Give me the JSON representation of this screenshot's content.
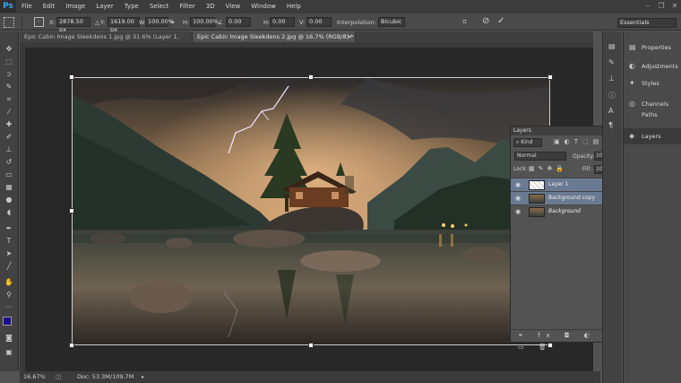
{
  "app": {
    "logo": "Ps"
  },
  "menu": [
    "File",
    "Edit",
    "Image",
    "Layer",
    "Type",
    "Select",
    "Filter",
    "3D",
    "View",
    "Window",
    "Help"
  ],
  "window_controls": {
    "minimize": "–",
    "restore": "❐",
    "close": "✕"
  },
  "options": {
    "x_label": "X:",
    "x_value": "2878.50 px",
    "y_label": "Y:",
    "y_value": "1619.00 px",
    "w_label": "W:",
    "w_value": "100.00%",
    "h_label": "H:",
    "h_value": "100.00%",
    "angle_label": "∠",
    "angle_value": "0.00",
    "hskew_label": "H:",
    "hskew_value": "0.00",
    "vskew_label": "V:",
    "vskew_value": "0.00",
    "interp_label": "Interpolation:",
    "interp_value": "Bicubic",
    "workspace": "Essentials"
  },
  "tabs": [
    {
      "label": "Epic Cabin Image Sleekdens 1.jpg @ 31.6% (Layer 1, RGB/8) *",
      "close": "×"
    },
    {
      "label": "Epic Cabin Image Sleekdens 2.jpg @ 16.7% (RGB/8) *",
      "close": "×"
    }
  ],
  "status": {
    "zoom": "16.67%",
    "doc": "Doc: 53.3M/109.7M"
  },
  "dock": {
    "items": [
      "Properties",
      "Adjustments",
      "Styles",
      "Channels",
      "Paths",
      "Layers"
    ]
  },
  "layers_panel": {
    "title": "Layers",
    "kind_label": "Kind",
    "blend_mode": "Normal",
    "opacity_label": "Opacity:",
    "opacity_value": "100%",
    "lock_label": "Lock:",
    "fill_label": "Fill:",
    "fill_value": "100%",
    "layers": [
      {
        "name": "Layer 1",
        "selected": true
      },
      {
        "name": "Background copy",
        "selected": true
      },
      {
        "name": "Background",
        "selected": false
      }
    ]
  },
  "colors": {
    "foreground": "#1a0f8a",
    "background": "#ffffff",
    "selection": "#6a7a92"
  }
}
